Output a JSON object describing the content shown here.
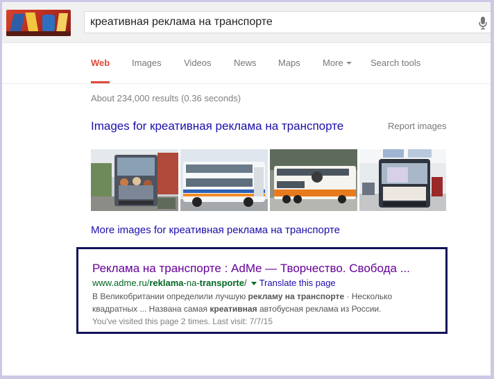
{
  "search": {
    "query": "креативная реклама на транспорте"
  },
  "tabs": {
    "web": "Web",
    "images": "Images",
    "videos": "Videos",
    "news": "News",
    "maps": "Maps",
    "more": "More",
    "search_tools": "Search tools"
  },
  "stats": "About 234,000 results (0.36 seconds)",
  "images_block": {
    "heading": "Images for креативная реклама на транспорте",
    "report": "Report images",
    "more_link": "More images for креативная реклама на транспорте",
    "thumbnails": [
      "bus rear with painted crowd",
      "white and blue double-decker bus",
      "white and orange double-decker bus",
      "bus rear with poster ad"
    ]
  },
  "result": {
    "title": "Реклама на транспорте : AdMe — Творчество. Свобода ...",
    "url_prefix": "www.adme.ru/",
    "url_bold_1": "reklama",
    "url_mid": "-na-",
    "url_bold_2": "transporte",
    "url_suffix": "/",
    "translate": "Translate this page",
    "snippet1_a": "В Великобритании определили лучшую ",
    "snippet1_b": "рекламу на транспорте",
    "snippet1_c": " · Несколько",
    "snippet2_a": "квадратных ... Названа самая ",
    "snippet2_b": "креативная",
    "snippet2_c": " автобусная реклама из России.",
    "visited": "You've visited this page 2 times. Last visit: 7/7/15"
  },
  "colors": {
    "accent_tab": "#dd4b39",
    "link": "#1a0dab",
    "visited_link": "#660099",
    "url_green": "#006621",
    "highlight_border": "#12115a"
  },
  "icons": [
    "google-doodle-logo",
    "microphone-icon",
    "dropdown-caret-icon"
  ]
}
